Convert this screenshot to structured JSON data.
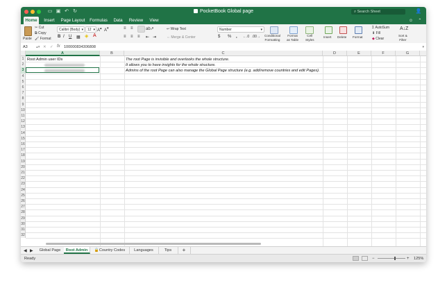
{
  "window": {
    "title": "PocketBook Global page",
    "search_placeholder": "Search Sheet"
  },
  "tabs": [
    "Home",
    "Insert",
    "Page Layout",
    "Formulas",
    "Data",
    "Review",
    "View"
  ],
  "active_tab": "Home",
  "ribbon": {
    "paste": "Paste",
    "cut": "Cut",
    "copy": "Copy",
    "format_painter": "Format",
    "font_name": "Calibri (Body)",
    "font_size": "12",
    "bold": "B",
    "italic": "I",
    "underline": "U",
    "wrap_text": "Wrap Text",
    "merge_center": "Merge & Center",
    "number_format": "Number",
    "currency": "$",
    "percent": "%",
    "comma": ",",
    "conditional_formatting": "Conditional\nFormatting",
    "format_as_table": "Format\nas Table",
    "cell_styles": "Cell\nStyles",
    "insert": "Insert",
    "delete": "Delete",
    "format": "Format",
    "autosum": "AutoSum",
    "fill": "Fill",
    "clear": "Clear",
    "sort_filter": "Sort &\nFilter"
  },
  "formula_bar": {
    "name_box": "A3",
    "fx": "fx",
    "value": "100000834306808"
  },
  "columns": [
    "A",
    "B",
    "C",
    "D",
    "E",
    "F",
    "G",
    "H"
  ],
  "selected_column": "A",
  "rows": [
    "1",
    "2",
    "3",
    "4",
    "5",
    "6",
    "7",
    "8",
    "9",
    "10",
    "11",
    "12",
    "13",
    "14",
    "15",
    "16",
    "17",
    "18",
    "19",
    "20",
    "21",
    "22",
    "23",
    "24",
    "25",
    "26",
    "27",
    "28",
    "29",
    "30",
    "31",
    "32"
  ],
  "selected_row": "3",
  "cells": {
    "A1": "Root Admin user IDs",
    "C1": "The root Page is invisible and overlooks the whole structure.",
    "C2": "It allows you to have insights for the whole structure.",
    "C3": "Admins of the root Page can also manage the Global Page structure (e.g. add/remove countries and edit Pages)."
  },
  "sheet_tabs": [
    {
      "label": "Global Page",
      "active": false,
      "locked": false
    },
    {
      "label": "Root Admin",
      "active": true,
      "locked": false
    },
    {
      "label": "Country Codes",
      "active": false,
      "locked": true
    },
    {
      "label": "Languages",
      "active": false,
      "locked": false
    },
    {
      "label": "Tips",
      "active": false,
      "locked": false
    }
  ],
  "add_sheet": "+",
  "status": {
    "ready": "Ready",
    "zoom": "125%",
    "minus": "−",
    "plus": "+"
  },
  "colors": {
    "accent": "#207346",
    "close": "#fe5f57",
    "minimize": "#febc2e",
    "maximize": "#28c840"
  }
}
